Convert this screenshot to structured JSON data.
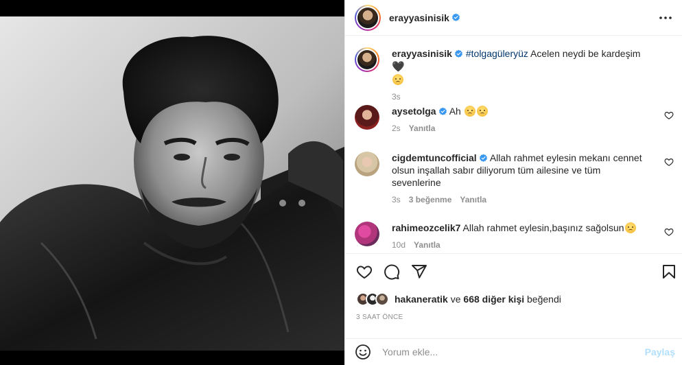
{
  "post": {
    "author": "erayyasinisik",
    "more_icon": "more-horizontal-icon",
    "photo_alt": "black-and-white portrait photo"
  },
  "caption": {
    "author": "erayyasinisik",
    "hashtag": "#tolgagüleryüz",
    "text": "Acelen neydi be kardeşim",
    "emoji_heart": "🖤",
    "time": "3s"
  },
  "comments": [
    {
      "author": "aysetolga",
      "verified": true,
      "text": "Ah",
      "time": "2s",
      "likes": "",
      "reply": "Yanıtla"
    },
    {
      "author": "cigdemtuncofficial",
      "verified": true,
      "text": "Allah rahmet eylesin mekanı cennet olsun inşallah sabır diliyorum tüm ailesine ve tüm sevenlerine",
      "time": "3s",
      "likes": "3 beğenme",
      "reply": "Yanıtla"
    },
    {
      "author": "rahimeozcelik7",
      "verified": false,
      "text": "Allah rahmet eylesin,başınız sağolsun",
      "time": "10d",
      "likes": "",
      "reply": "Yanıtla"
    }
  ],
  "likes": {
    "liker": "hakaneratik",
    "connector": "ve",
    "others": "668 diğer kişi",
    "suffix": "beğendi"
  },
  "timestamp": "3 SAAT ÖNCE",
  "add_comment": {
    "placeholder": "Yorum ekle...",
    "post_label": "Paylaş"
  },
  "colors": {
    "verified": "#3897f0",
    "link": "#00376b",
    "muted": "#8e8e8e",
    "post_button": "#b2dffc"
  }
}
